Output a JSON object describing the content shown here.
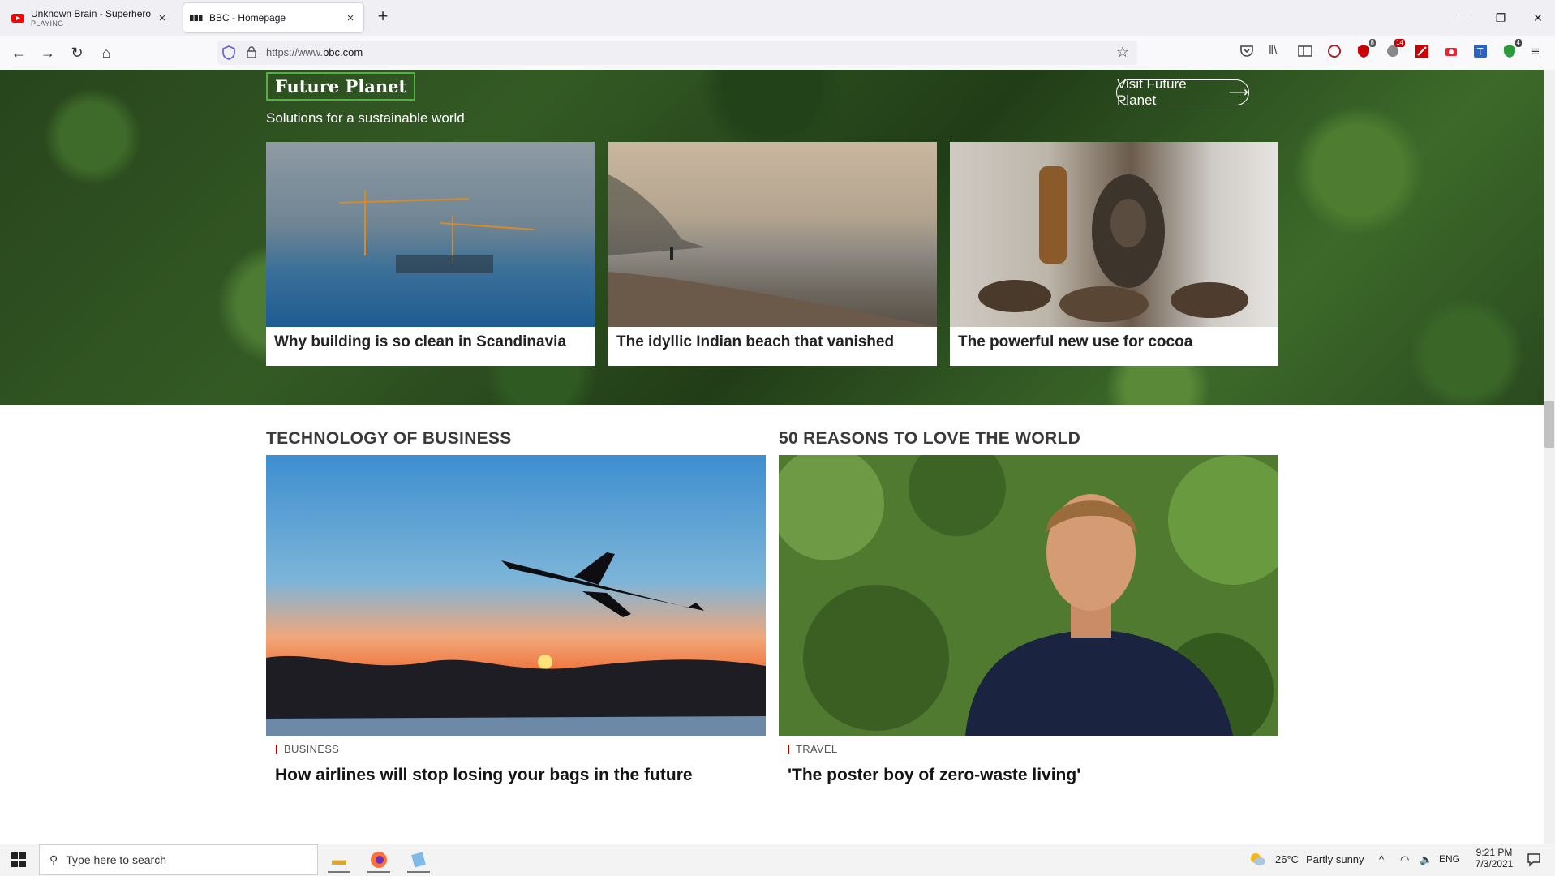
{
  "browser": {
    "tabs": [
      {
        "title": "Unknown Brain - Superhero (fe",
        "subtitle": "PLAYING"
      },
      {
        "title": "BBC - Homepage"
      }
    ],
    "url_prefix": "https://www.",
    "url_domain": "bbc.com",
    "badges": {
      "ext1": "8",
      "ext2": "14",
      "ext3": "4"
    }
  },
  "future_planet": {
    "badge": "Future Planet",
    "subtitle": "Solutions for a sustainable world",
    "visit_label": "Visit Future Planet",
    "cards": [
      {
        "caption": "Why building is so clean in Scandinavia"
      },
      {
        "caption": "The idyllic Indian beach that vanished"
      },
      {
        "caption": "The powerful new use for cocoa"
      }
    ]
  },
  "sections": {
    "left": {
      "title": "TECHNOLOGY OF BUSINESS",
      "tag": "BUSINESS",
      "headline": "How airlines will stop losing your bags in the future"
    },
    "right": {
      "title": "50 REASONS TO LOVE THE WORLD",
      "tag": "TRAVEL",
      "headline": "'The poster boy of zero-waste living'"
    }
  },
  "taskbar": {
    "search_placeholder": "Type here to search",
    "weather_temp": "26°C",
    "weather_text": "Partly sunny",
    "lang": "ENG",
    "time": "9:21 PM",
    "date": "7/3/2021"
  }
}
